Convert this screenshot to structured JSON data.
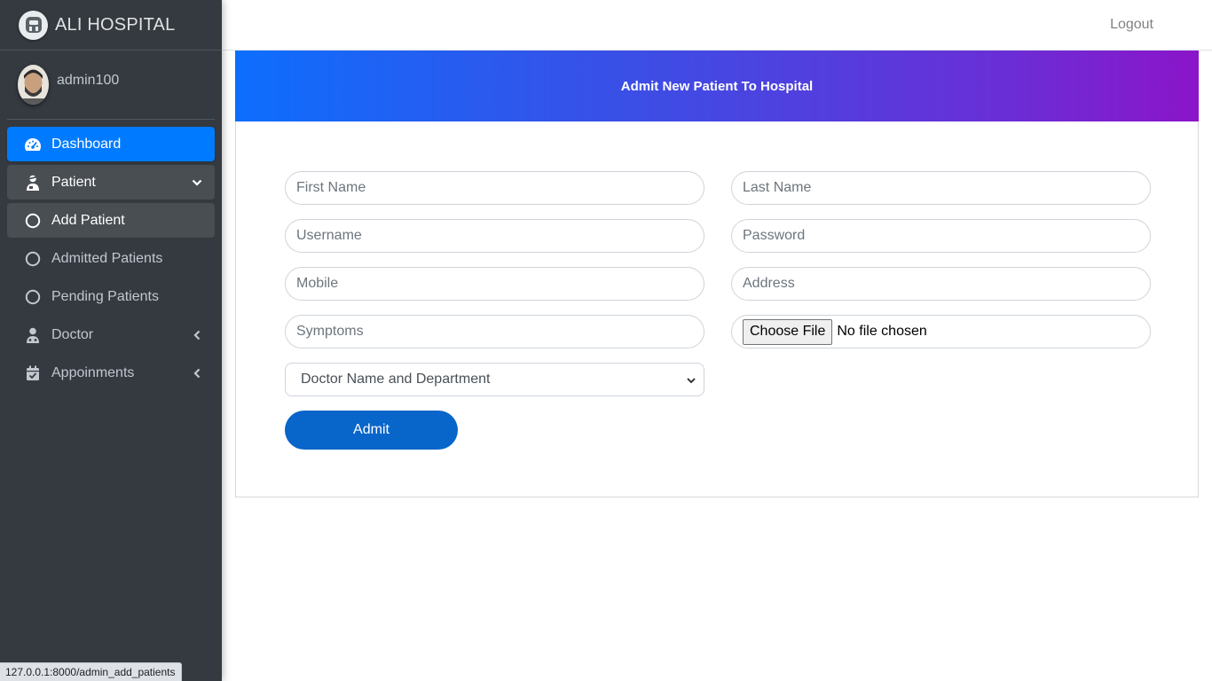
{
  "brand": {
    "name": "ALI HOSPITAL",
    "logo_icon": "hospital-logo-icon"
  },
  "user": {
    "name": "admin100"
  },
  "navbar": {
    "logout_label": "Logout"
  },
  "sidebar": {
    "items": [
      {
        "label": "Dashboard",
        "icon": "tachometer-icon",
        "state": "active"
      },
      {
        "label": "Patient",
        "icon": "user-injured-icon",
        "state": "open",
        "arrow": "chevron-down-icon"
      },
      {
        "label": "Add Patient",
        "icon": "circle-icon",
        "state": "sub-active"
      },
      {
        "label": "Admitted Patients",
        "icon": "circle-icon",
        "state": "normal"
      },
      {
        "label": "Pending Patients",
        "icon": "circle-icon",
        "state": "normal"
      },
      {
        "label": "Doctor",
        "icon": "user-md-icon",
        "state": "normal",
        "arrow": "chevron-left-icon"
      },
      {
        "label": "Appoinments",
        "icon": "calendar-check-icon",
        "state": "normal",
        "arrow": "chevron-left-icon"
      }
    ]
  },
  "form": {
    "title": "Admit New Patient To Hospital",
    "first_name_placeholder": "First Name",
    "last_name_placeholder": "Last Name",
    "username_placeholder": "Username",
    "password_placeholder": "Password",
    "mobile_placeholder": "Mobile",
    "address_placeholder": "Address",
    "symptoms_placeholder": "Symptoms",
    "file_button_label": "Choose File",
    "file_status": "No file chosen",
    "doctor_select_value": "Doctor Name and Department",
    "submit_label": "Admit"
  },
  "statusbar": {
    "url": "127.0.0.1:8000/admin_add_patients"
  },
  "colors": {
    "sidebar_bg": "#343a40",
    "active_nav": "#007bff",
    "submit_button": "#0865c9",
    "header_gradient_start": "#0d6efd",
    "header_gradient_end": "#8b15c9"
  }
}
